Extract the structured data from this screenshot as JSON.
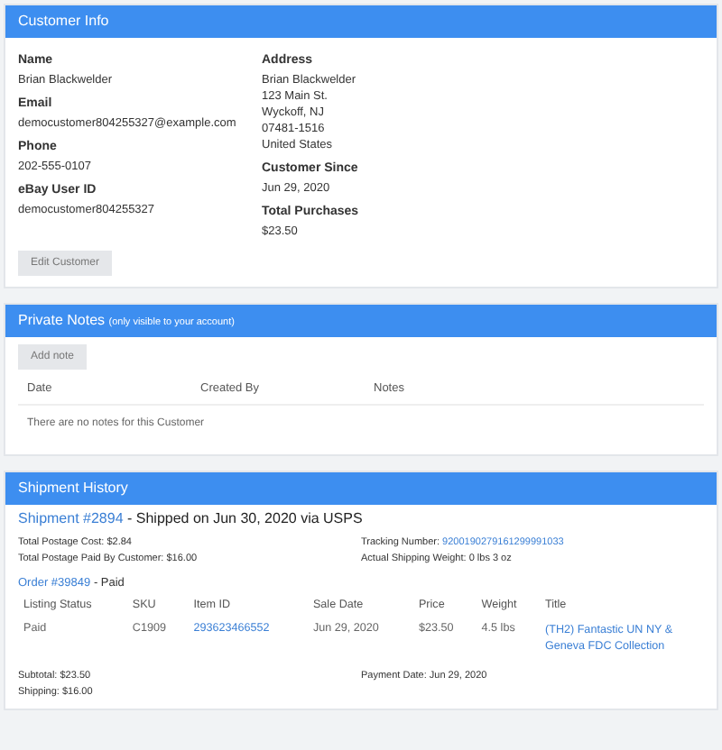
{
  "customer_info": {
    "title": "Customer Info",
    "left_fields": [
      {
        "label": "Name",
        "lines": [
          "Brian Blackwelder"
        ]
      },
      {
        "label": "Email",
        "lines": [
          "democustomer804255327@example.com"
        ]
      },
      {
        "label": "Phone",
        "lines": [
          "202-555-0107"
        ]
      },
      {
        "label": "eBay User ID",
        "lines": [
          "democustomer804255327"
        ]
      }
    ],
    "right_fields": [
      {
        "label": "Address",
        "lines": [
          "Brian Blackwelder",
          "123 Main St.",
          "Wyckoff, NJ",
          "07481-1516",
          "United States"
        ]
      },
      {
        "label": "Customer Since",
        "lines": [
          "Jun 29, 2020"
        ]
      },
      {
        "label": "Total Purchases",
        "lines": [
          "$23.50"
        ]
      }
    ],
    "edit_button": "Edit Customer"
  },
  "private_notes": {
    "title": "Private Notes",
    "subtitle": "(only visible to your account)",
    "add_button": "Add note",
    "columns": [
      "Date",
      "Created By",
      "Notes"
    ],
    "empty_text": "There are no notes for this Customer"
  },
  "shipment_history": {
    "title": "Shipment History",
    "shipment": {
      "link": "Shipment #2894",
      "text": "- Shipped on Jun 30, 2020 via USPS",
      "details_left": [
        "Total Postage Cost: $2.84",
        "Total Postage Paid By Customer: $16.00"
      ],
      "tracking_label": "Tracking Number:",
      "tracking_number": "9200190279161299991033",
      "weight": "Actual Shipping Weight: 0 lbs 3 oz"
    },
    "order": {
      "link": "Order #39849",
      "status": "- Paid",
      "columns": [
        "Listing Status",
        "SKU",
        "Item ID",
        "Sale Date",
        "Price",
        "Weight",
        "Title"
      ],
      "rows": [
        {
          "listing_status": "Paid",
          "sku": "C1909",
          "item_id": "293623466552",
          "sale_date": "Jun 29, 2020",
          "price": "$23.50",
          "weight": "4.5 lbs",
          "title": "(TH2) Fantastic UN NY & Geneva FDC Collection"
        }
      ],
      "summary_left": [
        "Subtotal: $23.50",
        "Shipping: $16.00"
      ],
      "payment_date": "Payment Date: Jun 29, 2020"
    }
  }
}
